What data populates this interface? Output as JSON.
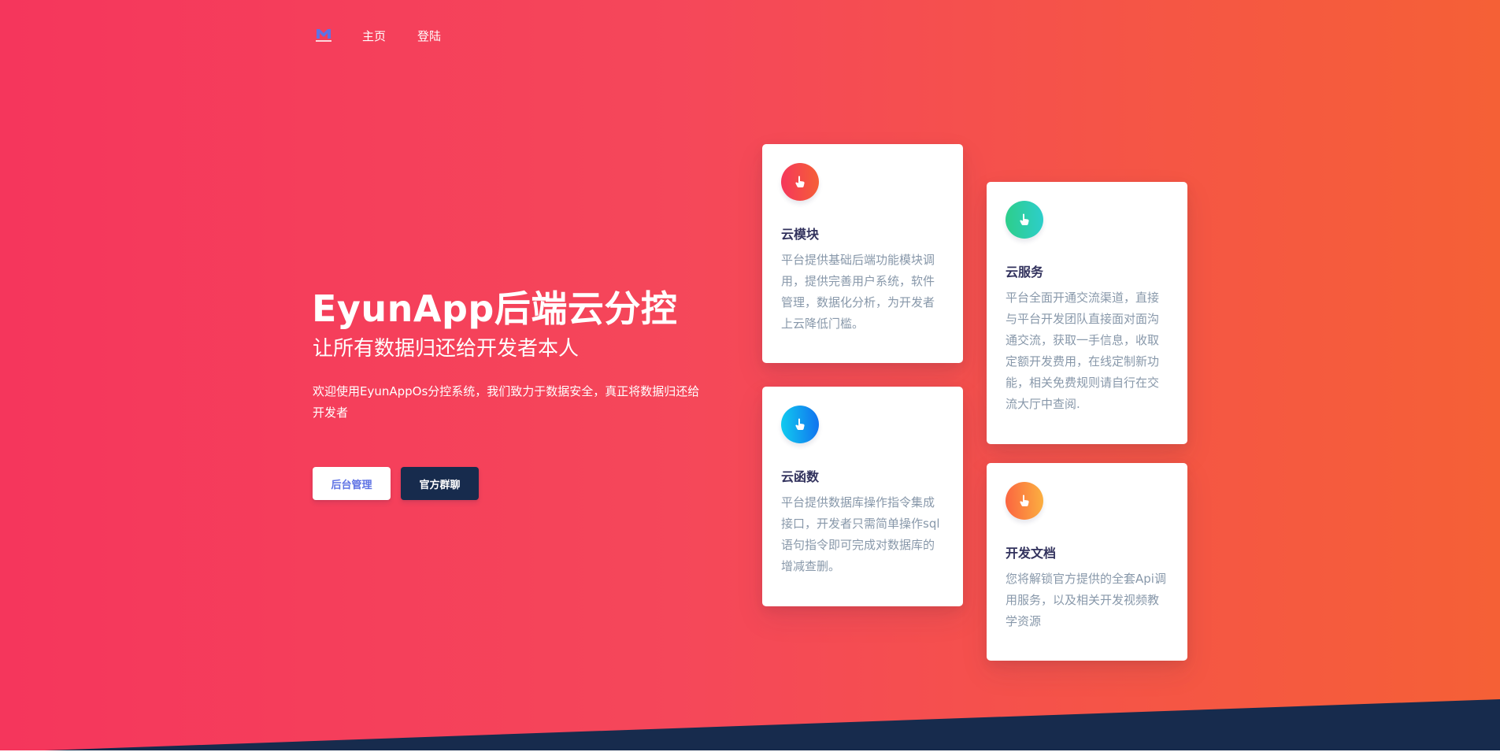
{
  "nav": {
    "logo_icon": "eyun-logo-icon",
    "links": [
      "主页",
      "登陆"
    ]
  },
  "hero": {
    "title": "EyunApp后端云分控",
    "subtitle": "让所有数据归还给开发者本人",
    "description": "欢迎使用EyunAppOs分控系统，我们致力于数据安全，真正将数据归还给开发者",
    "buttons": {
      "admin": "后台管理",
      "group": "官方群聊"
    }
  },
  "cards": [
    {
      "icon": "hand-pointer-icon",
      "title": "云模块",
      "text": "平台提供基础后端功能模块调用，提供完善用户系统，软件管理，数据化分析，为开发者上云降低门槛。"
    },
    {
      "icon": "hand-pointer-icon",
      "title": "云服务",
      "text": "平台全面开通交流渠道，直接与平台开发团队直接面对面沟通交流，获取一手信息，收取定额开发费用，在线定制新功能，相关免费规则请自行在交流大厅中查阅."
    },
    {
      "icon": "hand-pointer-icon",
      "title": "云函数",
      "text": "平台提供数据库操作指令集成接口，开发者只需简单操作sql语句指令即可完成对数据库的增减查删。"
    },
    {
      "icon": "hand-pointer-icon",
      "title": "开发文档",
      "text": "您将解锁官方提供的全套Api调用服务，以及相关开发视频教学资源"
    }
  ],
  "colors": {
    "gradient_start": "#f5365c",
    "gradient_end": "#f56036",
    "dark": "#172b4d",
    "primary": "#5e72e4"
  }
}
